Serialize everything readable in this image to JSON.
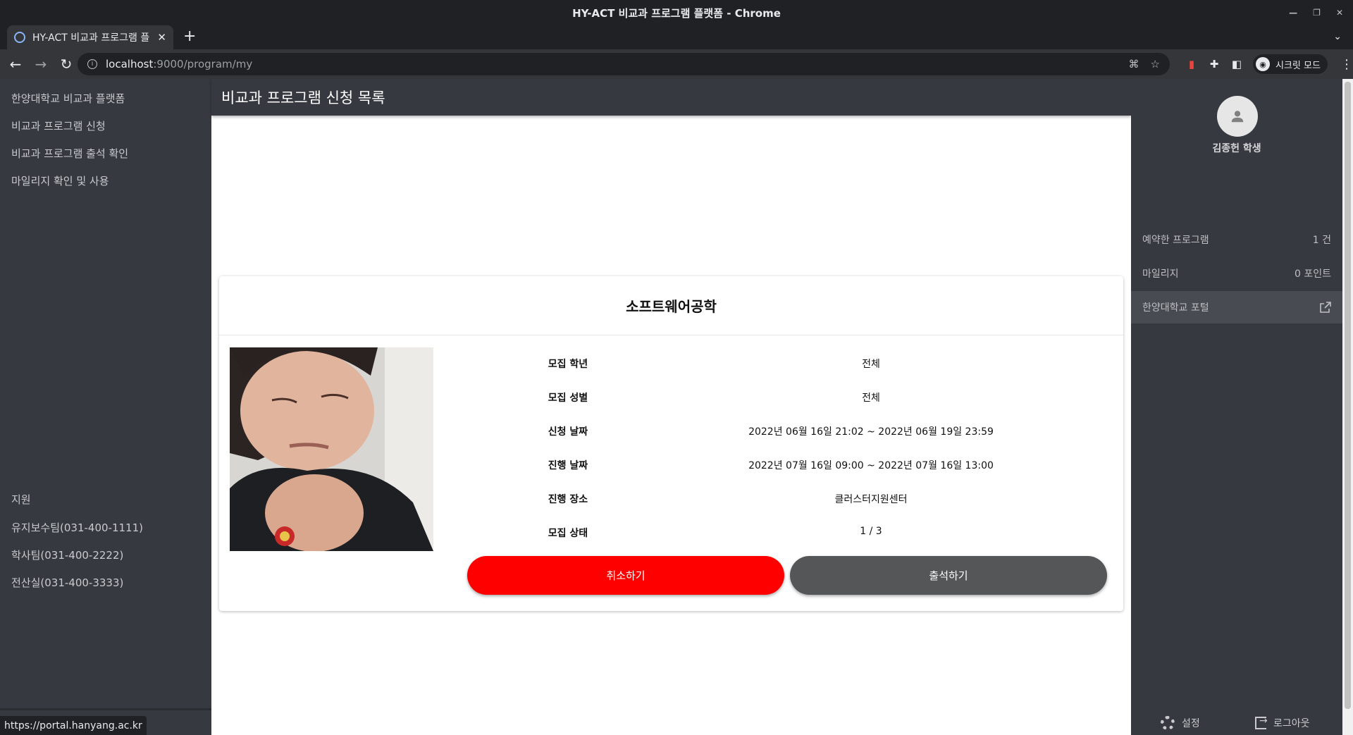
{
  "browser": {
    "window_title": "HY-ACT 비교과 프로그램 플랫폼 - Chrome",
    "tab_title": "HY-ACT 비교과 프로그램 플",
    "url_host": "localhost",
    "url_path": ":9000/program/my",
    "profile_label": "시크릿 모드",
    "status_url": "https://portal.hanyang.ac.kr"
  },
  "leftnav": {
    "items": [
      {
        "label": "한양대학교 비교과 플랫폼"
      },
      {
        "label": "비교과 프로그램 신청"
      },
      {
        "label": "비교과 프로그램 출석 확인"
      },
      {
        "label": "마일리지 확인 및 사용"
      }
    ],
    "support_heading": "지원",
    "support_items": [
      {
        "label": "유지보수팀(031-400-1111)"
      },
      {
        "label": "학사팀(031-400-2222)"
      },
      {
        "label": "전산실(031-400-3333)"
      }
    ]
  },
  "appbar": {
    "title": "비교과 프로그램 신청 목록"
  },
  "program": {
    "title": "소프트웨어공학",
    "rows": [
      {
        "label": "모집 학년",
        "value": "전체"
      },
      {
        "label": "모집 성별",
        "value": "전체"
      },
      {
        "label": "신청 날짜",
        "value": "2022년 06월 16일 21:02 ~ 2022년 06월 19일 23:59"
      },
      {
        "label": "진행 날짜",
        "value": "2022년 07월 16일 09:00 ~ 2022년 07월 16일 13:00"
      },
      {
        "label": "진행 장소",
        "value": "클러스터지원센터"
      },
      {
        "label": "모집 상태",
        "value": "1 / 3"
      }
    ],
    "cancel_label": "취소하기",
    "attend_label": "출석하기",
    "colors": {
      "cancel": "#ff0000",
      "attend": "#555658"
    }
  },
  "rightpanel": {
    "user_name": "김종헌 학생",
    "rows": [
      {
        "label": "예약한 프로그램",
        "value": "1 건"
      },
      {
        "label": "마일리지",
        "value": "0 포인트"
      },
      {
        "label": "한양대학교 포털",
        "value": ""
      }
    ],
    "settings_label": "설정",
    "logout_label": "로그아웃"
  }
}
